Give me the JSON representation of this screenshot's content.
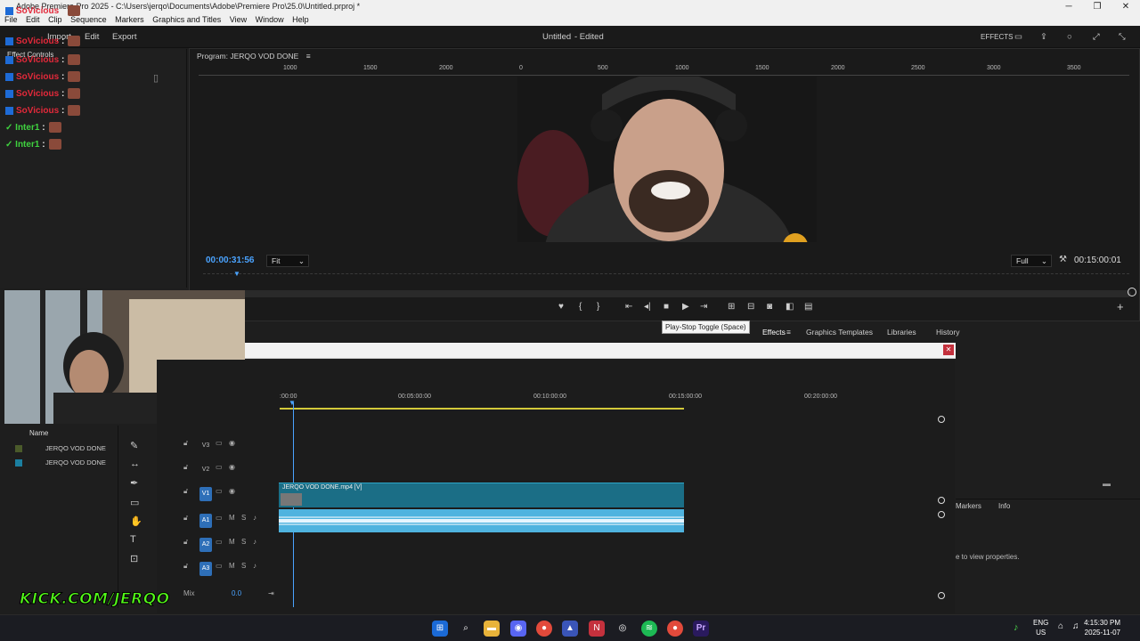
{
  "window": {
    "title": "Adobe Premiere Pro 2025 - C:\\Users\\jerqo\\Documents\\Adobe\\Premiere Pro\\25.0\\Untitled.prproj *",
    "minimize": "─",
    "maximize": "❐",
    "close": "✕"
  },
  "menu": [
    "File",
    "Edit",
    "Clip",
    "Sequence",
    "Markers",
    "Graphics and Titles",
    "View",
    "Window",
    "Help"
  ],
  "header": {
    "import": "Import",
    "edit": "Edit",
    "export": "Export",
    "doc_title": "Untitled",
    "doc_status": "- Edited",
    "effects_label": "EFFECTS"
  },
  "effect_controls": {
    "title": "Effect Controls",
    "chat": [
      {
        "user": "SoVicious",
        "text": ":"
      },
      {
        "user": "SoVicious",
        "text": ":"
      },
      {
        "user": "SoVicious",
        "text": ":"
      },
      {
        "user": "SoVicious",
        "text": ":"
      },
      {
        "user": "SoVicious",
        "text": ":"
      },
      {
        "user": "SoVicious",
        "text": ":"
      },
      {
        "user": "Inter1",
        "text": ":"
      },
      {
        "user": "Inter1",
        "text": ":"
      }
    ]
  },
  "program": {
    "tab": "Program: JERQO VOD DONE",
    "ruler_ticks": [
      "1000",
      "1500",
      "2000",
      "0",
      "500",
      "1000",
      "1500",
      "2000",
      "2500",
      "3000",
      "3500"
    ],
    "timecode": "00:00:31:56",
    "fit": "Fit",
    "quality": "Full",
    "duration": "00:15:00:01",
    "tooltip": "Play-Stop Toggle (Space)"
  },
  "panels": {
    "tabs": [
      "Effects",
      "Graphics Templates",
      "Libraries",
      "History"
    ],
    "lower_tabs": [
      "Markers",
      "Info"
    ],
    "hint": "e to view properties."
  },
  "project": {
    "column": "Name",
    "items": [
      "JERQO VOD DONE",
      "JERQO VOD DONE"
    ]
  },
  "timeline": {
    "ticks": [
      ":00:00",
      "00:05:00:00",
      "00:10:00:00",
      "00:15:00:00",
      "00:20:00:00"
    ],
    "video_tracks": [
      "V3",
      "V2",
      "V1"
    ],
    "audio_tracks": [
      "A1",
      "A2",
      "A3"
    ],
    "mix_label": "Mix",
    "mix_value": "0.0",
    "clip_title": "JERQO VOD DONE.mp4 [V]"
  },
  "stream": {
    "kick": "KICK.COM/JERQO"
  },
  "taskbar": {
    "lang_1": "ENG",
    "lang_2": "US",
    "time": "4:15:30 PM",
    "date": "2025-11-07"
  }
}
